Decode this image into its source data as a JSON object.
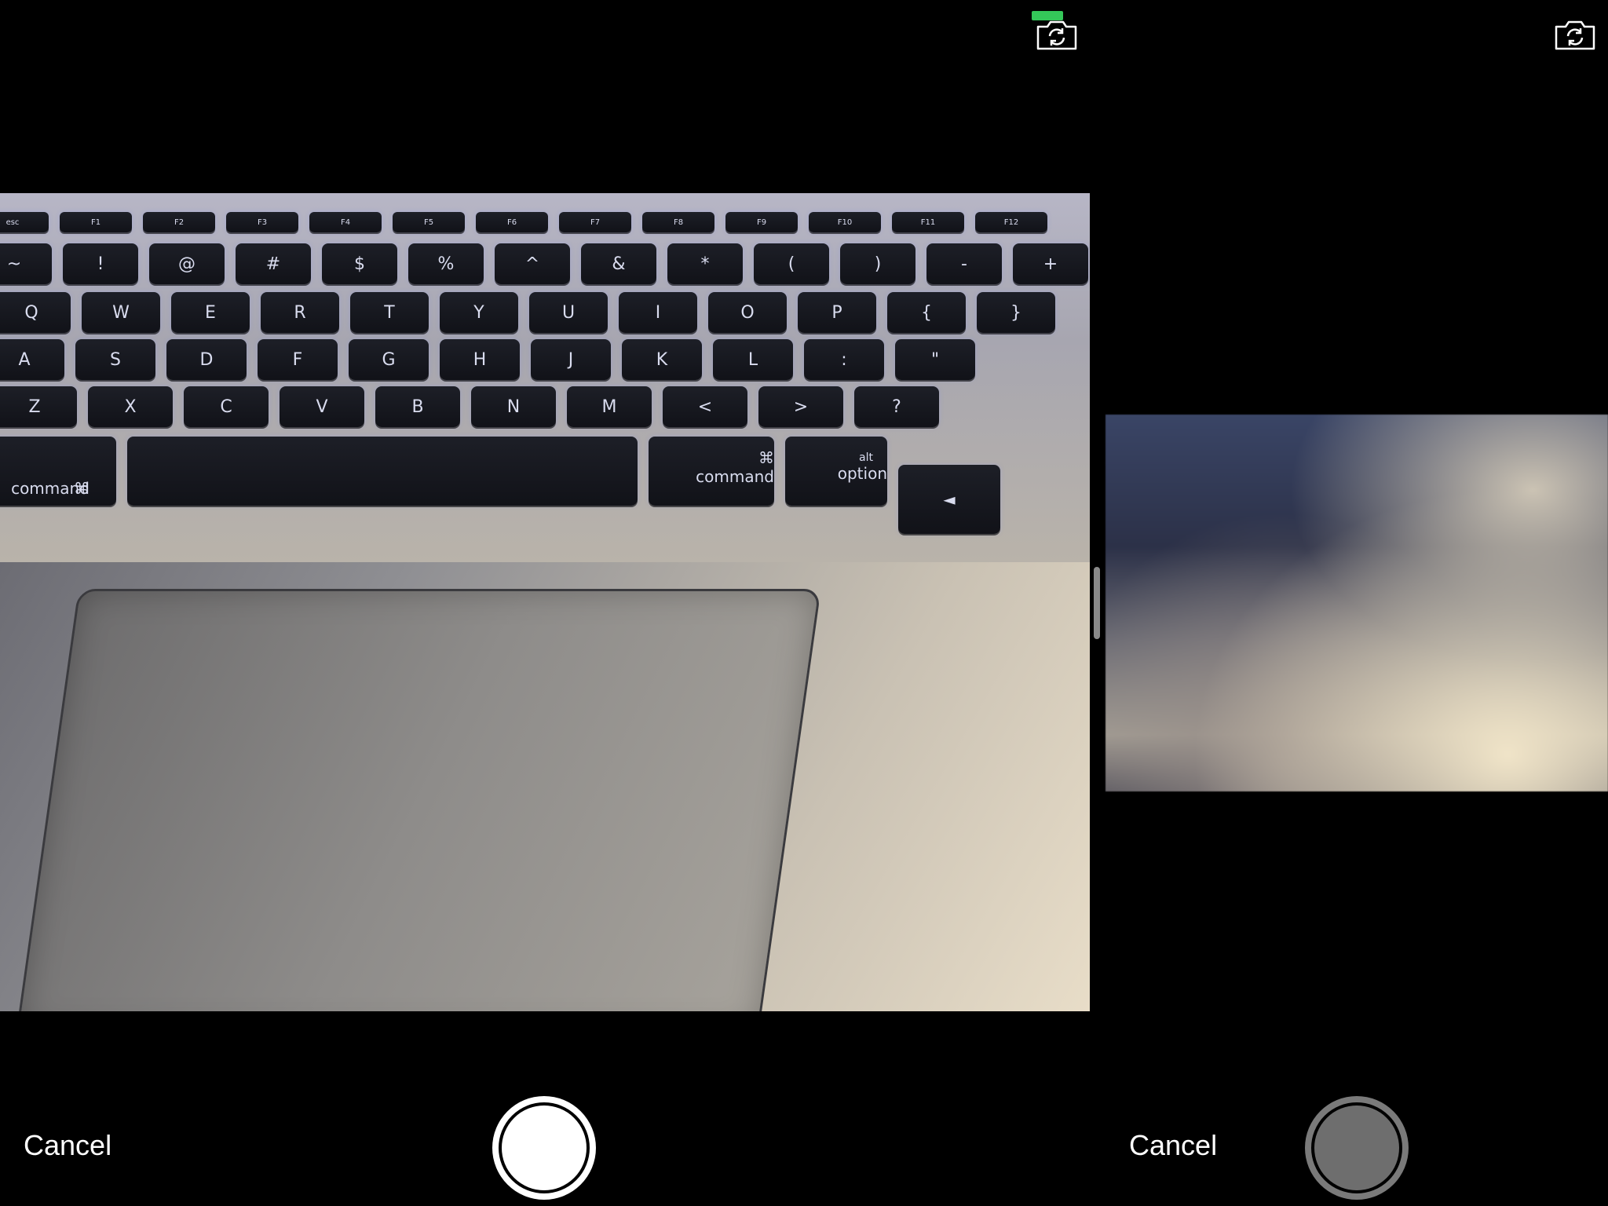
{
  "left_pane": {
    "cancel_label": "Cancel",
    "switch_camera_icon": "camera-rotate-icon",
    "indicator_color": "#34c759",
    "shutter_state": "enabled",
    "keyboard": {
      "row0": [
        "esc",
        "F1",
        "F2",
        "F3",
        "F4",
        "F5",
        "F6",
        "F7",
        "F8",
        "F9",
        "F10",
        "F11",
        "F12"
      ],
      "row1": [
        "~",
        "!",
        "@",
        "#",
        "$",
        "%",
        "^",
        "&",
        "*",
        "(",
        ")",
        "-",
        "+"
      ],
      "row2": [
        "Q",
        "W",
        "E",
        "R",
        "T",
        "Y",
        "U",
        "I",
        "O",
        "P",
        "{",
        "}"
      ],
      "row3": [
        "A",
        "S",
        "D",
        "F",
        "G",
        "H",
        "J",
        "K",
        "L",
        ":",
        "\""
      ],
      "row4": [
        "Z",
        "X",
        "C",
        "V",
        "B",
        "N",
        "M",
        "<",
        ">",
        "?"
      ],
      "row5": {
        "cmd_left": "command",
        "cmd_left_symbol": "⌘",
        "cmd_right": "command",
        "cmd_right_symbol": "⌘",
        "option": "option",
        "option_alt": "alt",
        "arrow": "◄"
      }
    }
  },
  "right_pane": {
    "cancel_label": "Cancel",
    "switch_camera_icon": "camera-rotate-icon",
    "shutter_state": "disabled"
  }
}
